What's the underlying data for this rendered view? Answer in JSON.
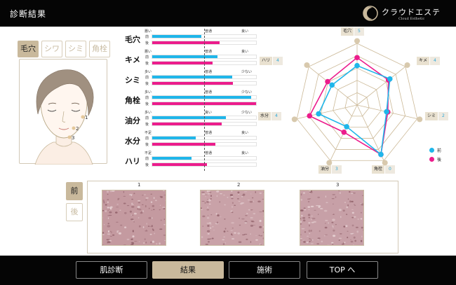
{
  "header": {
    "title": "診断結果",
    "brand": "クラウドエステ",
    "brand_sub": "Cloud Esthetic"
  },
  "tabs": [
    "毛穴",
    "シワ",
    "シミ",
    "角栓"
  ],
  "face_points": [
    "1",
    "2",
    "3"
  ],
  "bars": [
    {
      "label": "毛穴",
      "low": "悪い",
      "mid": "普通",
      "high": "良い",
      "before_tag": "前",
      "after_tag": "後",
      "before": 0.47,
      "after": 0.65
    },
    {
      "label": "キメ",
      "low": "悪い",
      "mid": "普通",
      "high": "良い",
      "before_tag": "前",
      "after_tag": "後",
      "before": 0.63,
      "after": 0.58
    },
    {
      "label": "シミ",
      "low": "多い",
      "mid": "普通",
      "high": "少ない",
      "before_tag": "前",
      "after_tag": "後",
      "before": 0.77,
      "after": 0.78
    },
    {
      "label": "角栓",
      "low": "多い",
      "mid": "普通",
      "high": "少ない",
      "before_tag": "前",
      "after_tag": "後",
      "before": 0.95,
      "after": 1.0
    },
    {
      "label": "油分",
      "low": "多い",
      "mid": "良い",
      "high": "少ない",
      "before_tag": "前",
      "after_tag": "後",
      "before": 0.71,
      "after": 0.67
    },
    {
      "label": "水分",
      "low": "不足",
      "mid": "普通",
      "high": "良い",
      "before_tag": "前",
      "after_tag": "後",
      "before": 0.42,
      "after": 0.61
    },
    {
      "label": "ハリ",
      "low": "不足",
      "mid": "普通",
      "high": "良い",
      "before_tag": "前",
      "after_tag": "後",
      "before": 0.38,
      "after": 0.53
    }
  ],
  "radar": {
    "axes": [
      {
        "name": "毛穴",
        "value": "5"
      },
      {
        "name": "キメ",
        "value": "4"
      },
      {
        "name": "シミ",
        "value": "2"
      },
      {
        "name": "角栓",
        "value": "0"
      },
      {
        "name": "油分",
        "value": "3"
      },
      {
        "name": "水分",
        "value": "4"
      },
      {
        "name": "ハリ",
        "value": "4"
      }
    ],
    "before": [
      0.64,
      0.68,
      0.49,
      0.89,
      0.39,
      0.64,
      0.52
    ],
    "after": [
      0.77,
      0.65,
      0.51,
      0.89,
      0.49,
      0.79,
      0.61
    ],
    "colors": {
      "before": "#1fb6ea",
      "after": "#ec1c8c",
      "grid": "#cbb896"
    }
  },
  "legend": {
    "before": "前",
    "after": "後"
  },
  "side_buttons": [
    "前",
    "後"
  ],
  "photos": [
    "1",
    "2",
    "3"
  ],
  "footer": [
    "肌診断",
    "結果",
    "施術",
    "TOP へ"
  ]
}
